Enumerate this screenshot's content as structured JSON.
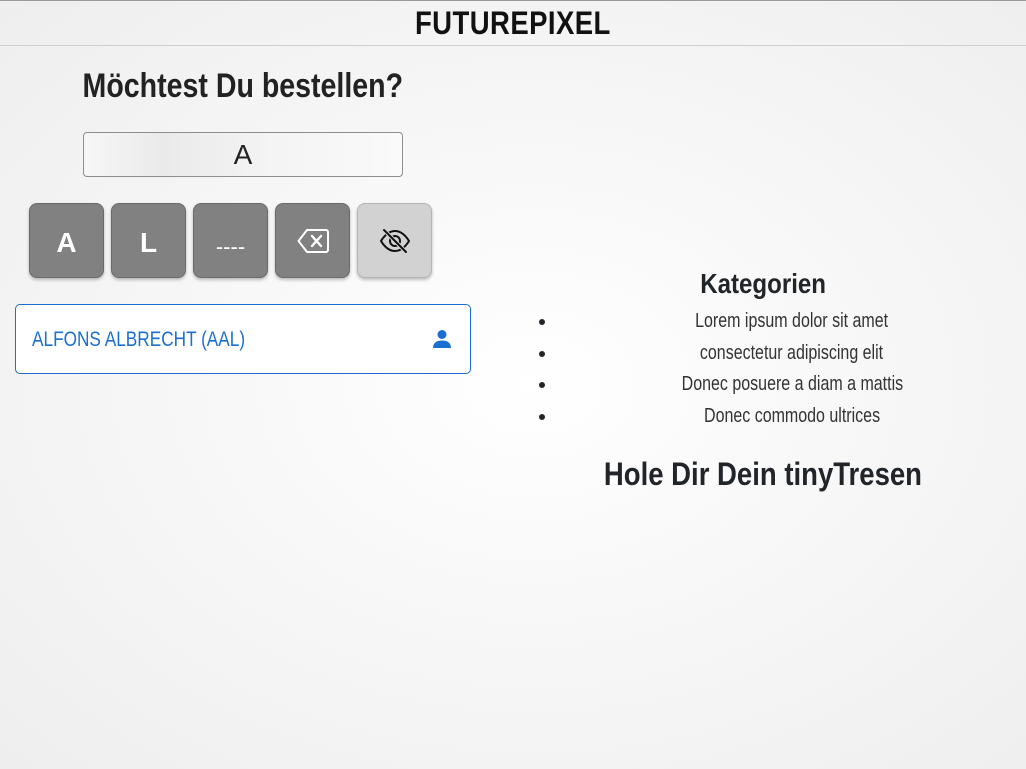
{
  "header": {
    "brand": "FUTUREPIXEL"
  },
  "order": {
    "title": "Möchtest Du bestellen?",
    "code_input_value": "A",
    "keys": [
      {
        "label": "A"
      },
      {
        "label": "L"
      },
      {
        "label": "----"
      },
      {
        "icon": "backspace-icon"
      },
      {
        "icon": "eye-slash-icon"
      }
    ],
    "suggestion": {
      "label": "ALFONS ALBRECHT (AAL)",
      "icon": "person-icon"
    }
  },
  "categories": {
    "title": "Kategorien",
    "items": [
      "Lorem ipsum dolor sit amet",
      "consectetur adipiscing elit",
      "Donec posuere a diam a mattis",
      "Donec commodo ultrices"
    ]
  },
  "promo": {
    "text": "Hole Dir Dein tinyTresen"
  },
  "colors": {
    "accent": "#1a6fd1",
    "key_dark": "#818181",
    "key_light": "#d2d2d2"
  }
}
